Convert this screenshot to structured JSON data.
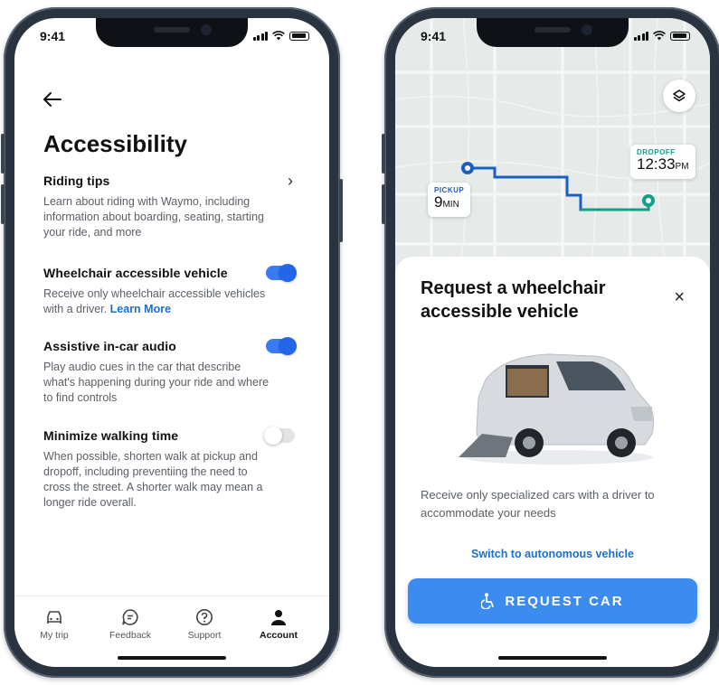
{
  "left_phone": {
    "status": {
      "time": "9:41"
    },
    "page_title": "Accessibility",
    "riding_tips": {
      "title": "Riding tips",
      "description": "Learn about riding with Waymo, including information about boarding, seating, starting your ride, and more"
    },
    "wheelchair": {
      "title": "Wheelchair accessible vehicle",
      "description": "Receive only wheelchair accessible vehicles with a driver.",
      "link": "Learn More",
      "enabled": true
    },
    "audio": {
      "title": "Assistive in-car audio",
      "description": "Play audio cues in the car that describe what's happening during your ride and where to find controls",
      "enabled": true
    },
    "walking": {
      "title": "Minimize walking time",
      "description": "When possible, shorten walk at pickup and dropoff, including preventiing the need to cross the street. A shorter walk may mean a longer ride overall.",
      "enabled": false
    },
    "tabs": [
      {
        "label": "My trip",
        "icon": "car-icon"
      },
      {
        "label": "Feedback",
        "icon": "chat-icon"
      },
      {
        "label": "Support",
        "icon": "help-icon"
      },
      {
        "label": "Account",
        "icon": "person-icon"
      }
    ],
    "active_tab": "Account"
  },
  "right_phone": {
    "status": {
      "time": "9:41"
    },
    "pickup": {
      "label": "PICKUP",
      "value": "9",
      "unit": "MIN"
    },
    "dropoff": {
      "label": "DROPOFF",
      "value": "12:33",
      "unit": "PM"
    },
    "sheet_title": "Request a wheelchair accessible vehicle",
    "close": "×",
    "description": "Receive only specialized cars with a driver to accommodate your needs",
    "switch_link": "Switch to autonomous vehicle",
    "request_button": "REQUEST CAR",
    "colors": {
      "accent": "#3c8cf0",
      "route_blue": "#1b5fbf",
      "route_green": "#13a089"
    }
  }
}
